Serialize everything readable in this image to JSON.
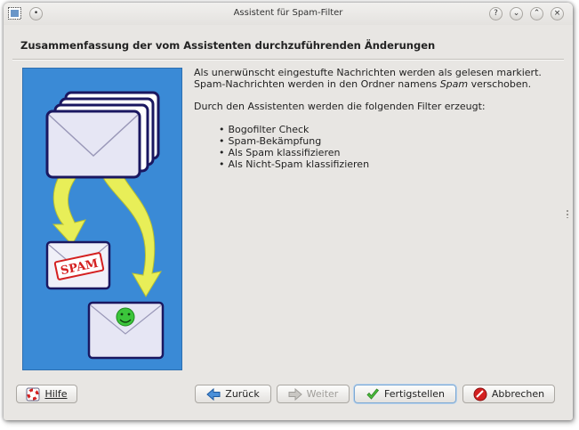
{
  "window": {
    "title": "Assistent für Spam-Filter",
    "controls": [
      "help",
      "minimize",
      "maximize",
      "close"
    ]
  },
  "heading": "Zusammenfassung der vom Assistenten durchzuführenden Änderungen",
  "description": {
    "line1": "Als unerwünscht eingestufte Nachrichten werden als gelesen markiert.",
    "line2_prefix": "Spam-Nachrichten werden in den Ordner namens ",
    "line2_folder": "Spam",
    "line2_suffix": " verschoben.",
    "filters_intro": "Durch den Assistenten werden die folgenden Filter erzeugt:",
    "filters": [
      "Bogofilter Check",
      "Spam-Bekämpfung",
      "Als Spam klassifizieren",
      "Als Nicht-Spam klassifizieren"
    ]
  },
  "illustration": {
    "stamp_text": "SPAM",
    "background": "#3a8ad6"
  },
  "buttons": {
    "help": {
      "label": "Hilfe",
      "icon": "help-icon"
    },
    "back": {
      "label": "Zurück",
      "icon": "arrow-left-icon"
    },
    "next": {
      "label": "Weiter",
      "icon": "arrow-right-icon",
      "enabled": false
    },
    "finish": {
      "label": "Fertigstellen",
      "icon": "checkmark-icon"
    },
    "cancel": {
      "label": "Abbrechen",
      "icon": "cancel-icon"
    }
  }
}
